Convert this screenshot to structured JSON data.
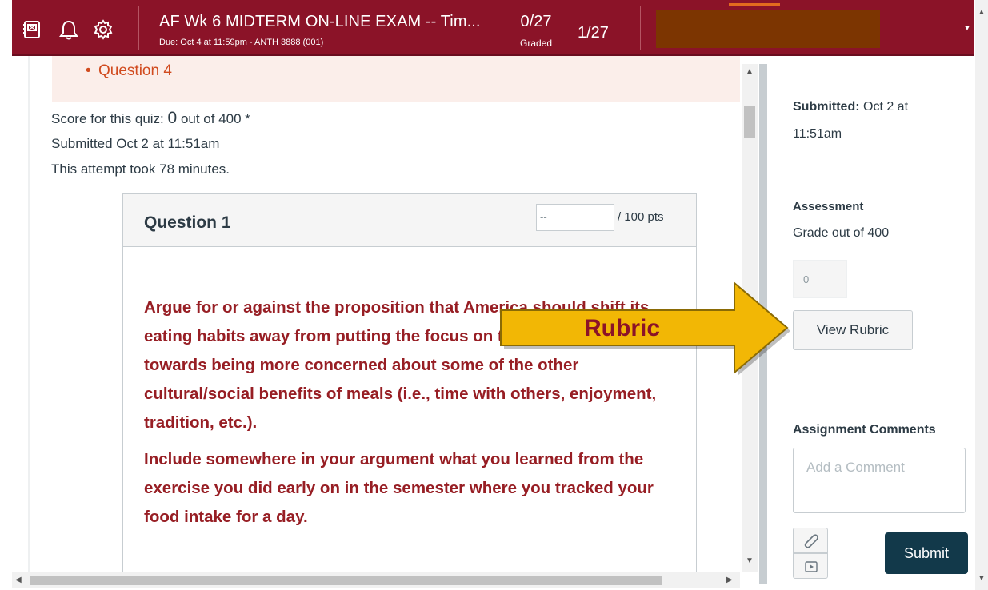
{
  "header": {
    "title": "AF Wk 6 MIDTERM ON-LINE EXAM -- Tim...",
    "subtitle": "Due: Oct 4 at 11:59pm - ANTH 3888 (001)",
    "graded_count": "0/27",
    "graded_label": "Graded",
    "pager": "1/27",
    "icons": [
      "notes-icon",
      "bell-icon",
      "gear-icon"
    ],
    "colors": {
      "bar": "#8b1328",
      "student_select": "#7c3501"
    }
  },
  "quiz": {
    "prev_item": "Question 4",
    "score_prefix": "Score for this quiz:",
    "score_value": "0",
    "score_suffix": "out of 400 *",
    "submitted": "Submitted Oct 2 at 11:51am",
    "attempt": "This attempt took 78 minutes.",
    "question": {
      "title": "Question 1",
      "points_placeholder": "--",
      "points_label": "/ 100 pts",
      "paragraph1": "Argue for or against the proposition that America should shift its eating habits away from putting the focus on the nutrients, and towards being more concerned about some of the other cultural/social benefits of meals (i.e., time with others, enjoyment, tradition, etc.).",
      "paragraph2": "Include somewhere in  your argument what you learned from the exercise you did early on in the semester where you tracked your food intake for a day."
    }
  },
  "sidebar": {
    "submitted_label": "Submitted:",
    "submitted_value": "Oct 2 at 11:51am",
    "assessment_heading": "Assessment",
    "grade_out_of": "Grade out of 400",
    "grade_value": "0",
    "view_rubric": "View Rubric",
    "comments_heading": "Assignment Comments",
    "comment_placeholder": "Add a Comment",
    "submit": "Submit"
  },
  "annotation": {
    "label": "Rubric",
    "color": "#f2b705"
  }
}
